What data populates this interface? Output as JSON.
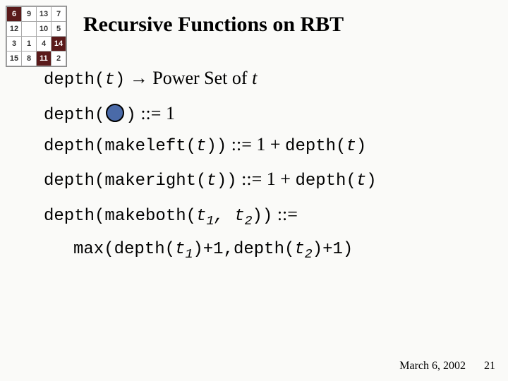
{
  "logo_grid": {
    "r0": {
      "c0": "6",
      "c1": "9",
      "c2": "13",
      "c3": "7"
    },
    "r1": {
      "c0": "12",
      "c1": "",
      "c2": "10",
      "c3": "5"
    },
    "r2": {
      "c0": "3",
      "c1": "1",
      "c2": "4",
      "c3": "14"
    },
    "r3": {
      "c0": "15",
      "c1": "8",
      "c2": "11",
      "c3": "2"
    }
  },
  "title": "Recursive Functions on RBT",
  "line1": {
    "a": "depth(",
    "b": "t",
    "c": ")",
    "d": " → Power Set of ",
    "e": "t"
  },
  "line2": {
    "a": "depth(",
    "b": ")",
    "c": " ::= 1"
  },
  "line3": {
    "a": "depth(makeleft(",
    "b": "t",
    "c": "))",
    "d": " ::= 1 + ",
    "e": "depth(",
    "f": "t",
    "g": ")"
  },
  "line4": {
    "a": "depth(makeright(",
    "b": "t",
    "c": "))",
    "d": " ::= 1 + ",
    "e": "depth(",
    "f": "t",
    "g": ")"
  },
  "line5": {
    "a": "depth(makeboth(",
    "b": "t",
    "c": "1",
    "d": ", ",
    "e": "t",
    "f": "2",
    "g": "))",
    "h": " ::="
  },
  "line6": {
    "a": "max(depth(",
    "b": "t",
    "c": "1",
    "d": ")+1,depth(",
    "e": "t",
    "f": "2",
    "g": ")+1)"
  },
  "footer": {
    "date": "March 6, 2002",
    "page": "21"
  }
}
